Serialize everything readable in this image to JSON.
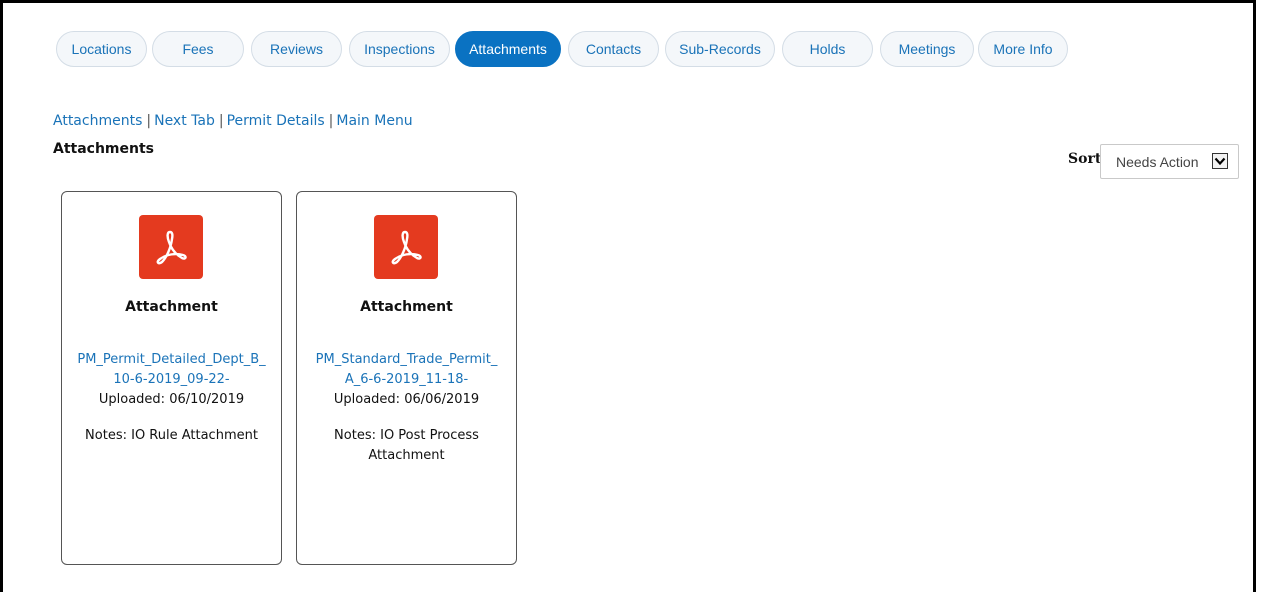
{
  "tabs": [
    {
      "label": "Locations",
      "active": false
    },
    {
      "label": "Fees",
      "active": false
    },
    {
      "label": "Reviews",
      "active": false
    },
    {
      "label": "Inspections",
      "active": false
    },
    {
      "label": "Attachments",
      "active": true
    },
    {
      "label": "Contacts",
      "active": false
    },
    {
      "label": "Sub-Records",
      "active": false
    },
    {
      "label": "Holds",
      "active": false
    },
    {
      "label": "Meetings",
      "active": false
    },
    {
      "label": "More Info",
      "active": false
    }
  ],
  "breadcrumb": {
    "items": [
      "Attachments",
      "Next Tab",
      "Permit Details",
      "Main Menu"
    ]
  },
  "section": {
    "title": "Attachments"
  },
  "sort": {
    "label": "Sort",
    "value": "Needs Action"
  },
  "colors": {
    "accent": "#0a72c2",
    "link": "#1a73b8",
    "pdf_icon": "#e43a1f"
  },
  "attachments": [
    {
      "icon": "pdf-icon",
      "title": "Attachment",
      "file_line1": "PM_Permit_Detailed_Dept_B_",
      "file_line2": "10-6-2019_09-22-",
      "uploaded": "Uploaded: 06/10/2019",
      "notes": "Notes: IO Rule Attachment"
    },
    {
      "icon": "pdf-icon",
      "title": "Attachment",
      "file_line1": "PM_Standard_Trade_Permit_",
      "file_line2": "A_6-6-2019_11-18-",
      "uploaded": "Uploaded: 06/06/2019",
      "notes": "Notes: IO Post Process Attachment"
    }
  ]
}
